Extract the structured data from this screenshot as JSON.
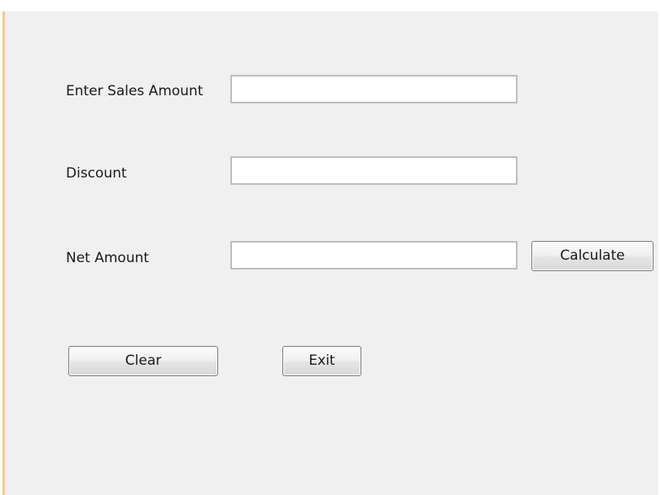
{
  "form": {
    "sales_label": "Enter Sales Amount",
    "sales_value": "",
    "discount_label": "Discount",
    "discount_value": "",
    "net_label": "Net Amount",
    "net_value": ""
  },
  "buttons": {
    "calculate": "Calculate",
    "clear": "Clear",
    "exit": "Exit"
  },
  "colors": {
    "frame_border": "#f6c27a",
    "background": "#f0f0f0"
  }
}
